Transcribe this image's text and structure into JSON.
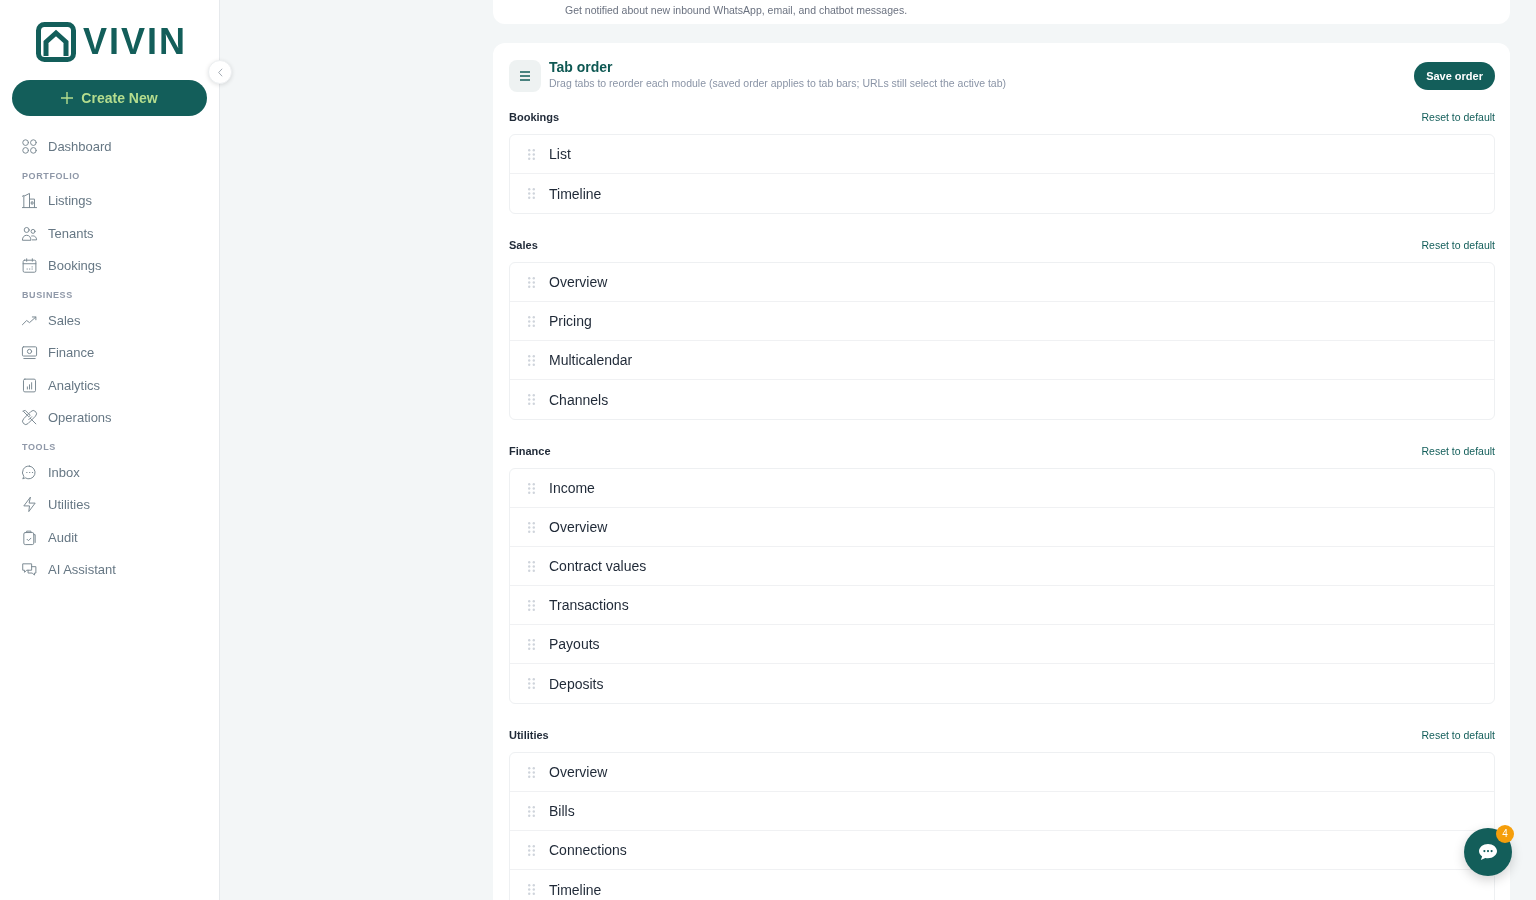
{
  "sidebar": {
    "logo": {
      "text": "VIVIN"
    },
    "create_button": {
      "label": "Create New"
    },
    "nav": [
      {
        "items": [
          {
            "label": "Dashboard",
            "selected": false
          }
        ]
      },
      {
        "heading": "PORTFOLIO",
        "items": [
          {
            "label": "Listings",
            "selected": false
          },
          {
            "label": "Tenants",
            "selected": false
          },
          {
            "label": "Bookings",
            "selected": false
          }
        ]
      },
      {
        "heading": "BUSINESS",
        "items": [
          {
            "label": "Sales",
            "selected": false
          },
          {
            "label": "Finance",
            "selected": false
          },
          {
            "label": "Analytics",
            "selected": false
          },
          {
            "label": "Operations",
            "selected": false
          }
        ]
      },
      {
        "heading": "TOOLS",
        "items": [
          {
            "label": "Inbox",
            "selected": false
          },
          {
            "label": "Utilities",
            "selected": false
          },
          {
            "label": "Audit",
            "selected": false
          },
          {
            "label": "AI Assistant",
            "selected": false
          }
        ]
      }
    ]
  },
  "notice": {
    "text": "Get notified about new inbound WhatsApp, email, and chatbot messages."
  },
  "tab_order": {
    "title": "Tab order",
    "subtitle": "Drag tabs to reorder each module (saved order applies to tab bars; URLs still select the active tab)",
    "save_button": "Save order",
    "modules": [
      {
        "name": "Bookings",
        "reset_link": "Reset to default",
        "tabs": [
          "List",
          "Timeline"
        ]
      },
      {
        "name": "Sales",
        "reset_link": "Reset to default",
        "tabs": [
          "Overview",
          "Pricing",
          "Multicalendar",
          "Channels"
        ]
      },
      {
        "name": "Finance",
        "reset_link": "Reset to default",
        "tabs": [
          "Income",
          "Overview",
          "Contract values",
          "Transactions",
          "Payouts",
          "Deposits"
        ]
      },
      {
        "name": "Utilities",
        "reset_link": "Reset to default",
        "tabs": [
          "Overview",
          "Bills",
          "Connections",
          "Timeline"
        ]
      }
    ]
  },
  "chat_button": {
    "badge": "4"
  }
}
